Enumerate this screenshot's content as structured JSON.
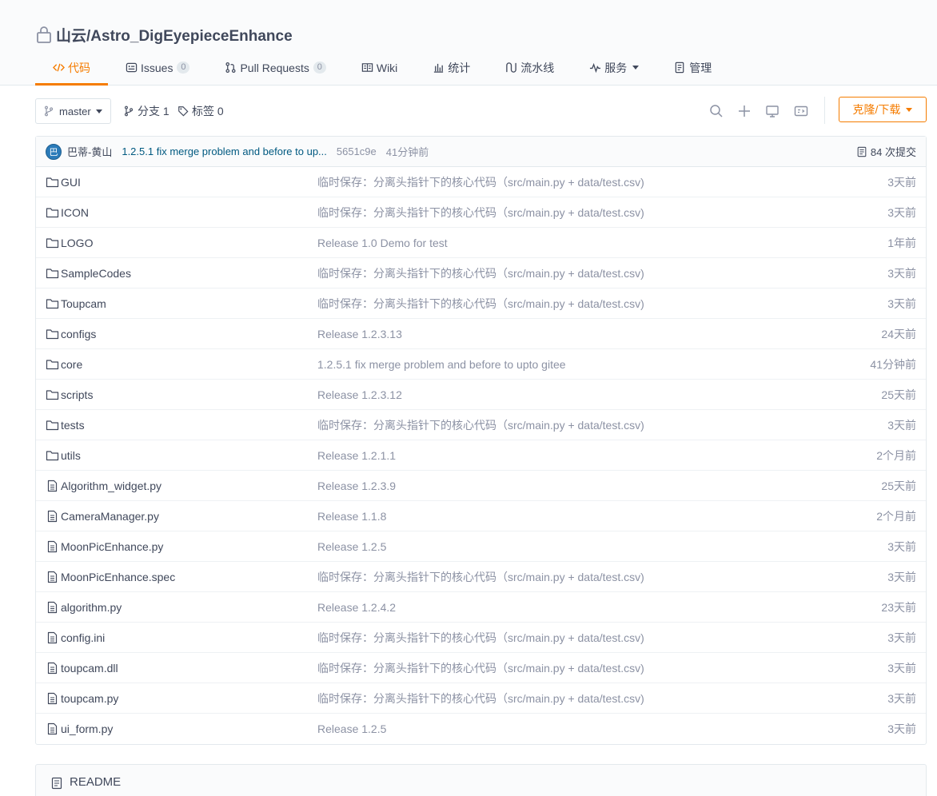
{
  "repo": {
    "title": "山云/Astro_DigEyepieceEnhance"
  },
  "colors": {
    "accent": "#f57c00",
    "link": "#005980",
    "muted": "#8c92a4",
    "text": "#40485b"
  },
  "tabs": [
    {
      "label": "代码",
      "icon": "code-icon",
      "active": true
    },
    {
      "label": "Issues",
      "icon": "issues-icon",
      "count": "0"
    },
    {
      "label": "Pull Requests",
      "icon": "pull-request-icon",
      "count": "0"
    },
    {
      "label": "Wiki",
      "icon": "wiki-icon"
    },
    {
      "label": "统计",
      "icon": "stats-icon"
    },
    {
      "label": "流水线",
      "icon": "pipeline-icon"
    },
    {
      "label": "服务",
      "icon": "service-icon",
      "dropdown": true
    },
    {
      "label": "管理",
      "icon": "manage-icon"
    }
  ],
  "toolbar": {
    "branch": "master",
    "branches_label": "分支 1",
    "tags_label": "标签 0",
    "clone_label": "克隆/下载"
  },
  "commit": {
    "avatar_text": "巴",
    "author": "巴蒂-黄山",
    "message": "1.2.5.1 fix merge problem and before to up...",
    "sha": "5651c9e",
    "time": "41分钟前",
    "count_label": "84 次提交"
  },
  "files": [
    {
      "type": "folder",
      "name": "GUI",
      "message": "临时保存：分离头指针下的核心代码（src/main.py + data/test.csv)",
      "time": "3天前"
    },
    {
      "type": "folder",
      "name": "ICON",
      "message": "临时保存：分离头指针下的核心代码（src/main.py + data/test.csv)",
      "time": "3天前"
    },
    {
      "type": "folder",
      "name": "LOGO",
      "message": "Release 1.0 Demo for test",
      "time": "1年前"
    },
    {
      "type": "folder",
      "name": "SampleCodes",
      "message": "临时保存：分离头指针下的核心代码（src/main.py + data/test.csv)",
      "time": "3天前"
    },
    {
      "type": "folder",
      "name": "Toupcam",
      "message": "临时保存：分离头指针下的核心代码（src/main.py + data/test.csv)",
      "time": "3天前"
    },
    {
      "type": "folder",
      "name": "configs",
      "message": "Release 1.2.3.13",
      "time": "24天前"
    },
    {
      "type": "folder",
      "name": "core",
      "message": "1.2.5.1 fix merge problem and before to upto gitee",
      "time": "41分钟前"
    },
    {
      "type": "folder",
      "name": "scripts",
      "message": "Release 1.2.3.12",
      "time": "25天前"
    },
    {
      "type": "folder",
      "name": "tests",
      "message": "临时保存：分离头指针下的核心代码（src/main.py + data/test.csv)",
      "time": "3天前"
    },
    {
      "type": "folder",
      "name": "utils",
      "message": "Release 1.2.1.1",
      "time": "2个月前"
    },
    {
      "type": "file",
      "name": "Algorithm_widget.py",
      "message": "Release 1.2.3.9",
      "time": "25天前"
    },
    {
      "type": "file",
      "name": "CameraManager.py",
      "message": "Release 1.1.8",
      "time": "2个月前"
    },
    {
      "type": "file",
      "name": "MoonPicEnhance.py",
      "message": "Release 1.2.5",
      "time": "3天前"
    },
    {
      "type": "file",
      "name": "MoonPicEnhance.spec",
      "message": "临时保存：分离头指针下的核心代码（src/main.py + data/test.csv)",
      "time": "3天前"
    },
    {
      "type": "file",
      "name": "algorithm.py",
      "message": "Release 1.2.4.2",
      "time": "23天前"
    },
    {
      "type": "file",
      "name": "config.ini",
      "message": "临时保存：分离头指针下的核心代码（src/main.py + data/test.csv)",
      "time": "3天前"
    },
    {
      "type": "file",
      "name": "toupcam.dll",
      "message": "临时保存：分离头指针下的核心代码（src/main.py + data/test.csv)",
      "time": "3天前"
    },
    {
      "type": "file",
      "name": "toupcam.py",
      "message": "临时保存：分离头指针下的核心代码（src/main.py + data/test.csv)",
      "time": "3天前"
    },
    {
      "type": "file",
      "name": "ui_form.py",
      "message": "Release 1.2.5",
      "time": "3天前"
    }
  ],
  "readme": {
    "title": "README"
  }
}
